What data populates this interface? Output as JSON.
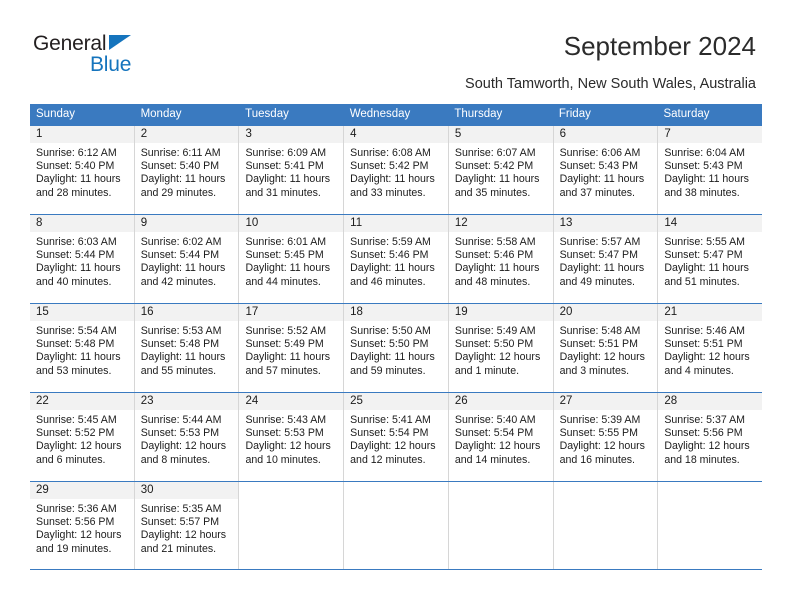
{
  "brand": {
    "name_top": "General",
    "name_bottom": "Blue",
    "triangle_color": "#1574bd"
  },
  "header": {
    "title": "September 2024",
    "subtitle": "South Tamworth, New South Wales, Australia"
  },
  "calendar": {
    "accent_color": "#3a7ac0",
    "weekdays": [
      "Sunday",
      "Monday",
      "Tuesday",
      "Wednesday",
      "Thursday",
      "Friday",
      "Saturday"
    ],
    "weeks": [
      [
        {
          "num": "1",
          "lines": [
            "Sunrise: 6:12 AM",
            "Sunset: 5:40 PM",
            "Daylight: 11 hours",
            "and 28 minutes."
          ]
        },
        {
          "num": "2",
          "lines": [
            "Sunrise: 6:11 AM",
            "Sunset: 5:40 PM",
            "Daylight: 11 hours",
            "and 29 minutes."
          ]
        },
        {
          "num": "3",
          "lines": [
            "Sunrise: 6:09 AM",
            "Sunset: 5:41 PM",
            "Daylight: 11 hours",
            "and 31 minutes."
          ]
        },
        {
          "num": "4",
          "lines": [
            "Sunrise: 6:08 AM",
            "Sunset: 5:42 PM",
            "Daylight: 11 hours",
            "and 33 minutes."
          ]
        },
        {
          "num": "5",
          "lines": [
            "Sunrise: 6:07 AM",
            "Sunset: 5:42 PM",
            "Daylight: 11 hours",
            "and 35 minutes."
          ]
        },
        {
          "num": "6",
          "lines": [
            "Sunrise: 6:06 AM",
            "Sunset: 5:43 PM",
            "Daylight: 11 hours",
            "and 37 minutes."
          ]
        },
        {
          "num": "7",
          "lines": [
            "Sunrise: 6:04 AM",
            "Sunset: 5:43 PM",
            "Daylight: 11 hours",
            "and 38 minutes."
          ]
        }
      ],
      [
        {
          "num": "8",
          "lines": [
            "Sunrise: 6:03 AM",
            "Sunset: 5:44 PM",
            "Daylight: 11 hours",
            "and 40 minutes."
          ]
        },
        {
          "num": "9",
          "lines": [
            "Sunrise: 6:02 AM",
            "Sunset: 5:44 PM",
            "Daylight: 11 hours",
            "and 42 minutes."
          ]
        },
        {
          "num": "10",
          "lines": [
            "Sunrise: 6:01 AM",
            "Sunset: 5:45 PM",
            "Daylight: 11 hours",
            "and 44 minutes."
          ]
        },
        {
          "num": "11",
          "lines": [
            "Sunrise: 5:59 AM",
            "Sunset: 5:46 PM",
            "Daylight: 11 hours",
            "and 46 minutes."
          ]
        },
        {
          "num": "12",
          "lines": [
            "Sunrise: 5:58 AM",
            "Sunset: 5:46 PM",
            "Daylight: 11 hours",
            "and 48 minutes."
          ]
        },
        {
          "num": "13",
          "lines": [
            "Sunrise: 5:57 AM",
            "Sunset: 5:47 PM",
            "Daylight: 11 hours",
            "and 49 minutes."
          ]
        },
        {
          "num": "14",
          "lines": [
            "Sunrise: 5:55 AM",
            "Sunset: 5:47 PM",
            "Daylight: 11 hours",
            "and 51 minutes."
          ]
        }
      ],
      [
        {
          "num": "15",
          "lines": [
            "Sunrise: 5:54 AM",
            "Sunset: 5:48 PM",
            "Daylight: 11 hours",
            "and 53 minutes."
          ]
        },
        {
          "num": "16",
          "lines": [
            "Sunrise: 5:53 AM",
            "Sunset: 5:48 PM",
            "Daylight: 11 hours",
            "and 55 minutes."
          ]
        },
        {
          "num": "17",
          "lines": [
            "Sunrise: 5:52 AM",
            "Sunset: 5:49 PM",
            "Daylight: 11 hours",
            "and 57 minutes."
          ]
        },
        {
          "num": "18",
          "lines": [
            "Sunrise: 5:50 AM",
            "Sunset: 5:50 PM",
            "Daylight: 11 hours",
            "and 59 minutes."
          ]
        },
        {
          "num": "19",
          "lines": [
            "Sunrise: 5:49 AM",
            "Sunset: 5:50 PM",
            "Daylight: 12 hours",
            "and 1 minute."
          ]
        },
        {
          "num": "20",
          "lines": [
            "Sunrise: 5:48 AM",
            "Sunset: 5:51 PM",
            "Daylight: 12 hours",
            "and 3 minutes."
          ]
        },
        {
          "num": "21",
          "lines": [
            "Sunrise: 5:46 AM",
            "Sunset: 5:51 PM",
            "Daylight: 12 hours",
            "and 4 minutes."
          ]
        }
      ],
      [
        {
          "num": "22",
          "lines": [
            "Sunrise: 5:45 AM",
            "Sunset: 5:52 PM",
            "Daylight: 12 hours",
            "and 6 minutes."
          ]
        },
        {
          "num": "23",
          "lines": [
            "Sunrise: 5:44 AM",
            "Sunset: 5:53 PM",
            "Daylight: 12 hours",
            "and 8 minutes."
          ]
        },
        {
          "num": "24",
          "lines": [
            "Sunrise: 5:43 AM",
            "Sunset: 5:53 PM",
            "Daylight: 12 hours",
            "and 10 minutes."
          ]
        },
        {
          "num": "25",
          "lines": [
            "Sunrise: 5:41 AM",
            "Sunset: 5:54 PM",
            "Daylight: 12 hours",
            "and 12 minutes."
          ]
        },
        {
          "num": "26",
          "lines": [
            "Sunrise: 5:40 AM",
            "Sunset: 5:54 PM",
            "Daylight: 12 hours",
            "and 14 minutes."
          ]
        },
        {
          "num": "27",
          "lines": [
            "Sunrise: 5:39 AM",
            "Sunset: 5:55 PM",
            "Daylight: 12 hours",
            "and 16 minutes."
          ]
        },
        {
          "num": "28",
          "lines": [
            "Sunrise: 5:37 AM",
            "Sunset: 5:56 PM",
            "Daylight: 12 hours",
            "and 18 minutes."
          ]
        }
      ],
      [
        {
          "num": "29",
          "lines": [
            "Sunrise: 5:36 AM",
            "Sunset: 5:56 PM",
            "Daylight: 12 hours",
            "and 19 minutes."
          ]
        },
        {
          "num": "30",
          "lines": [
            "Sunrise: 5:35 AM",
            "Sunset: 5:57 PM",
            "Daylight: 12 hours",
            "and 21 minutes."
          ]
        },
        {
          "num": "",
          "lines": []
        },
        {
          "num": "",
          "lines": []
        },
        {
          "num": "",
          "lines": []
        },
        {
          "num": "",
          "lines": []
        },
        {
          "num": "",
          "lines": []
        }
      ]
    ]
  }
}
